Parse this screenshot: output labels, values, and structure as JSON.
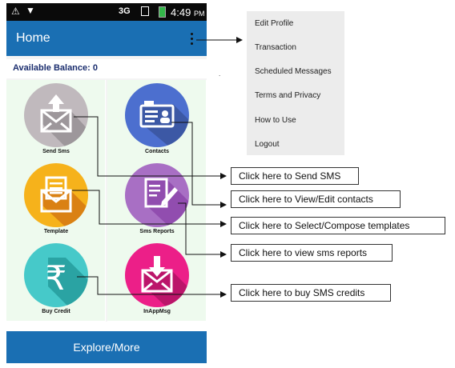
{
  "status_bar": {
    "network": "3G",
    "time": "4:49",
    "ampm": "PM"
  },
  "app_bar": {
    "title": "Home"
  },
  "balance": {
    "label": "Available Balance: 0"
  },
  "tiles": [
    {
      "label": "Send Sms",
      "color": "#c0b9bd",
      "icon": "mail-upload-icon"
    },
    {
      "label": "Contacts",
      "color": "#4c6fcf",
      "icon": "contact-card-icon"
    },
    {
      "label": "Template",
      "color": "#f6b21b",
      "icon": "mail-document-icon"
    },
    {
      "label": "Sms Reports",
      "color": "#a86fc4",
      "icon": "edit-document-icon"
    },
    {
      "label": "Buy Credit",
      "color": "#46c9c9",
      "icon": "rupee-icon"
    },
    {
      "label": "InAppMsg",
      "color": "#ec1f88",
      "icon": "mail-download-icon"
    }
  ],
  "explore_button": {
    "label": "Explore/More"
  },
  "overflow_menu": {
    "items": [
      "Edit Profile",
      "Transaction",
      "Scheduled Messages",
      "Terms and Privacy",
      "How to Use",
      "Logout"
    ]
  },
  "annotations": {
    "send_sms": "Click here to Send SMS",
    "contacts": "Click here to View/Edit contacts",
    "templates": "Click here to Select/Compose templates",
    "reports": "Click here to view sms reports",
    "credits": "Click here to buy SMS credits",
    "dot": "."
  },
  "colors": {
    "primary": "#1a6fb3",
    "tile_bg": "#eefaee",
    "balance_text": "#1a2d6e"
  }
}
